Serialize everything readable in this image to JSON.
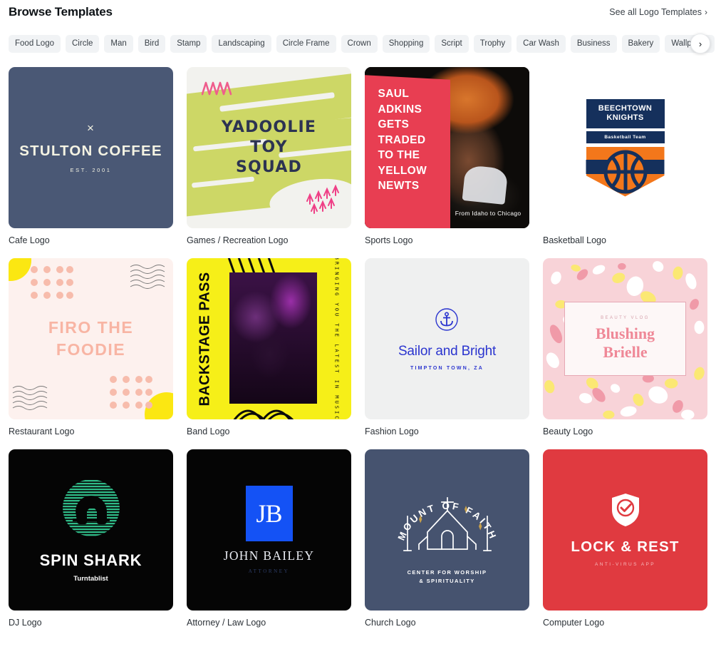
{
  "header": {
    "title": "Browse Templates",
    "see_all_label": "See all Logo Templates",
    "see_all_chevron": "›"
  },
  "tags": {
    "next_icon": "›",
    "items": [
      "Food Logo",
      "Circle",
      "Man",
      "Bird",
      "Stamp",
      "Landscaping",
      "Circle Frame",
      "Crown",
      "Shopping",
      "Script",
      "Trophy",
      "Car Wash",
      "Business",
      "Bakery",
      "Wallpaper"
    ]
  },
  "colors": {
    "page_bg": "#ffffff",
    "chip_bg": "#f1f3f5",
    "text": "#0d1216",
    "cafe_bg": "#4a5875",
    "games_bg": "#cdd766",
    "sports_accent": "#e83e52",
    "basketball_navy": "#15305c",
    "basketball_orange": "#f3771b",
    "restaurant_bg": "#fdf1ee",
    "restaurant_pink": "#f8b5a4",
    "restaurant_yellow": "#fbe712",
    "band_bg": "#f6ef18",
    "fashion_bg": "#eff0f0",
    "fashion_blue": "#2b35cf",
    "beauty_bg": "#f8d3d8",
    "beauty_pink": "#ef8897",
    "dj_bg": "#050505",
    "dj_green": "#2fba87",
    "law_blue": "#1452f5",
    "church_bg": "#46536f",
    "computer_red": "#e03a40"
  },
  "cards": [
    {
      "label": "Cafe Logo",
      "design": {
        "mark": "×",
        "name": "STULTON COFFEE",
        "established": "EST. 2001"
      }
    },
    {
      "label": "Games / Recreation Logo",
      "design": {
        "line1": "YADOOLIE",
        "line2": "TOY",
        "line3": "SQUAD"
      }
    },
    {
      "label": "Sports Logo",
      "design": {
        "headline": "SAUL ADKINS GETS TRADED TO THE YELLOW NEWTS",
        "headline_lines": [
          "SAUL",
          "ADKINS",
          "GETS",
          "TRADED",
          "TO THE",
          "YELLOW",
          "NEWTS"
        ],
        "caption": "From Idaho to Chicago"
      }
    },
    {
      "label": "Basketball Logo",
      "design": {
        "name_line1": "BEECHTOWN",
        "name_line2": "KNIGHTS",
        "subtitle": "Basketball Team"
      }
    },
    {
      "label": "Restaurant Logo",
      "design": {
        "line1": "FIRO THE",
        "line2": "FOODIE"
      }
    },
    {
      "label": "Band Logo",
      "design": {
        "title": "BACKSTAGE PASS",
        "tagline": "BRINGING YOU THE LATEST IN MUSIC"
      }
    },
    {
      "label": "Fashion Logo",
      "design": {
        "name": "Sailor and Bright",
        "location": "TIMPTON TOWN, ZA"
      }
    },
    {
      "label": "Beauty Logo",
      "design": {
        "eyebrow": "BEAUTY VLOG",
        "name_line1": "Blushing",
        "name_line2": "Brielle"
      }
    },
    {
      "label": "DJ Logo",
      "design": {
        "name": "SPIN SHARK",
        "subtitle": "Turntablist"
      }
    },
    {
      "label": "Attorney / Law Logo",
      "design": {
        "monogram": "JB",
        "name": "JOHN BAILEY",
        "subtitle": "ATTORNEY"
      }
    },
    {
      "label": "Church Logo",
      "design": {
        "arc_text": "MOUNT OF FAITH",
        "subtitle_line1": "CENTER FOR WORSHIP",
        "subtitle_line2": "& SPIRITUALITY"
      }
    },
    {
      "label": "Computer Logo",
      "design": {
        "name": "LOCK & REST",
        "subtitle": "ANTI-VIRUS APP"
      }
    }
  ]
}
